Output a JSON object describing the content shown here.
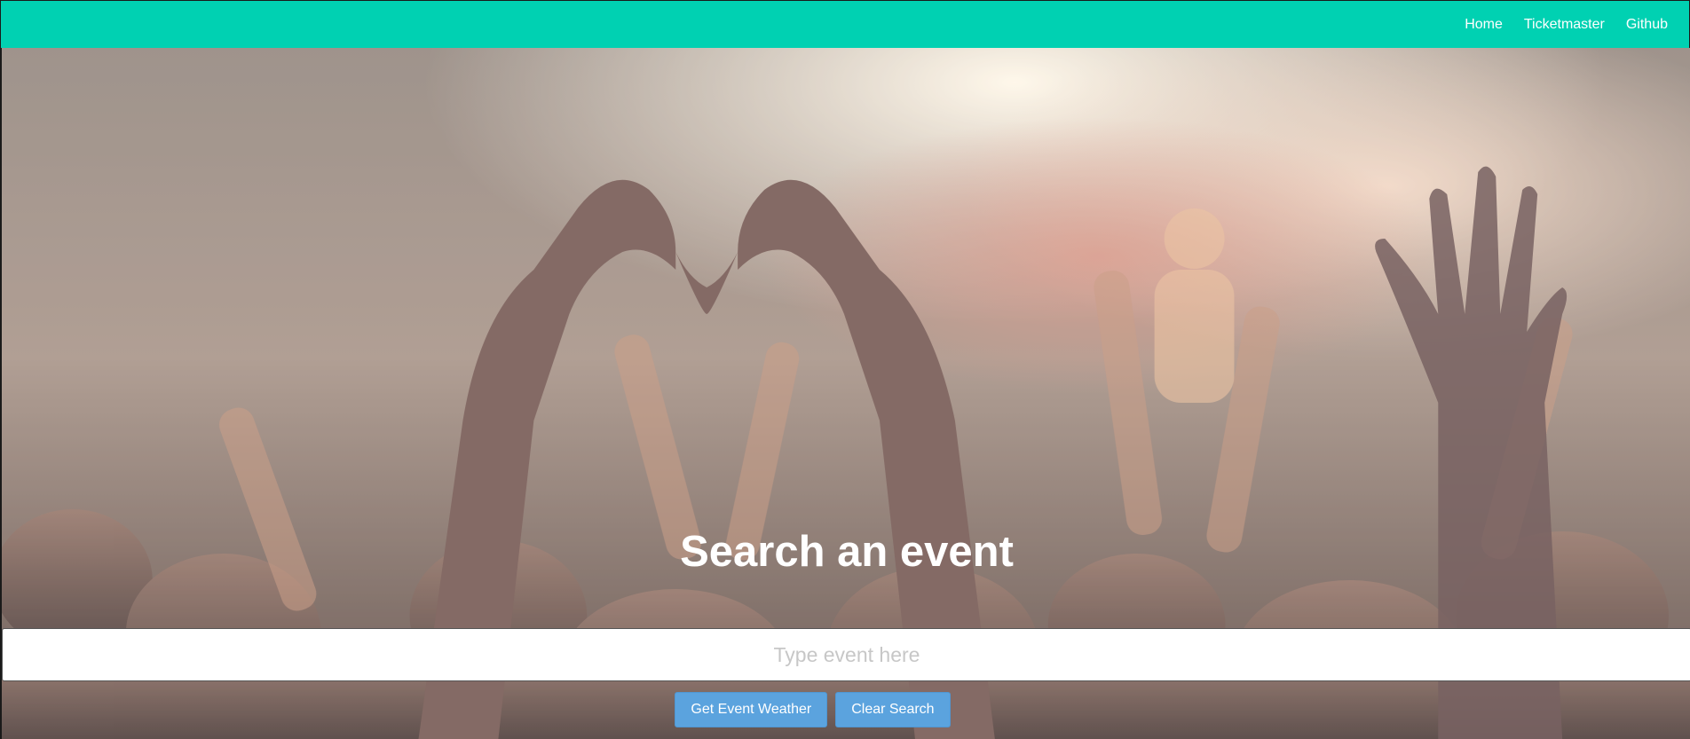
{
  "nav": {
    "links": [
      {
        "label": "Home"
      },
      {
        "label": "Ticketmaster"
      },
      {
        "label": "Github"
      }
    ],
    "accent_color": "#00d1b2"
  },
  "hero": {
    "image_description": "concert crowd with heart hands",
    "title": "Search an event",
    "search": {
      "placeholder": "Type event here",
      "value": ""
    },
    "buttons": {
      "weather_label": "Get Event Weather",
      "clear_label": "Clear Search",
      "color": "#5ba3de"
    }
  }
}
